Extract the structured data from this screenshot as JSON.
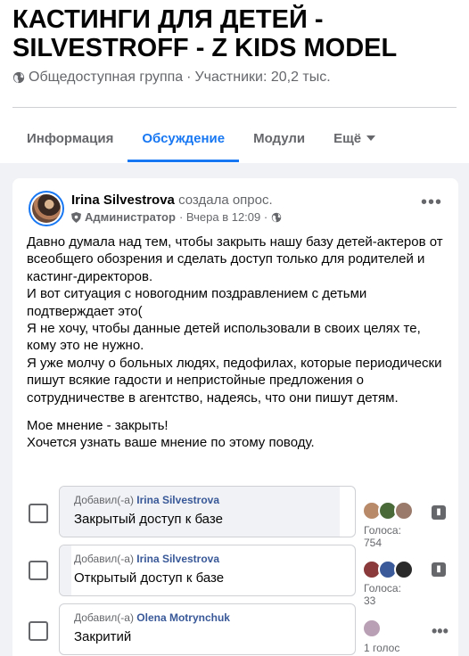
{
  "group": {
    "title": "КАСТИНГИ ДЛЯ ДЕТЕЙ - SILVESTROFF - Z KIDS MODEL",
    "privacy": "Общедоступная группа",
    "separator": "·",
    "members": "Участники: 20,2 тыс."
  },
  "tabs": [
    {
      "label": "Информация"
    },
    {
      "label": "Обсуждение"
    },
    {
      "label": "Модули"
    },
    {
      "label": "Ещё"
    }
  ],
  "post": {
    "author": "Irina Silvestrova",
    "action": "создала опрос.",
    "role": "Администратор",
    "time": "· Вчера в 12:09 ·",
    "more": "•••",
    "lines": [
      "Давно думала над тем, чтобы закрыть нашу базу детей-актеров от всеобщего обозрения и сделать доступ только для родителей и кастинг-директоров.",
      "И вот ситуация с новогодним поздравлением с детьми подтверждает это(",
      "Я не хочу, чтобы данные детей использовали в своих целях те, кому это не нужно.",
      "Я уже молчу о больных людях, педофилах, которые периодически пишут всякие гадости и непристойные предложения о сотрудничестве в агентство, надеясь, что они пишут детям."
    ],
    "closing": [
      "Мое мнение - закрыть!",
      "Хочется узнать ваше мнение по этому поводу."
    ]
  },
  "poll": {
    "added_by_prefix": "Добавил(-а)",
    "options": [
      {
        "author": "Irina Silvestrova",
        "text": "Закрытый доступ к базе",
        "votes": "Голоса: 754",
        "share": 0.95,
        "more": "▮"
      },
      {
        "author": "Irina Silvestrova",
        "text": "Открытый доступ к базе",
        "votes": "Голоса: 33",
        "share": 0.04,
        "more": "▮"
      },
      {
        "author": "Olena Motrynchuk",
        "text": "Закритий",
        "votes": "1 голос",
        "share": 0.0,
        "more": "•••"
      }
    ]
  },
  "colors": {
    "accent": "#1877f2",
    "link": "#385898",
    "muted": "#65676b"
  }
}
